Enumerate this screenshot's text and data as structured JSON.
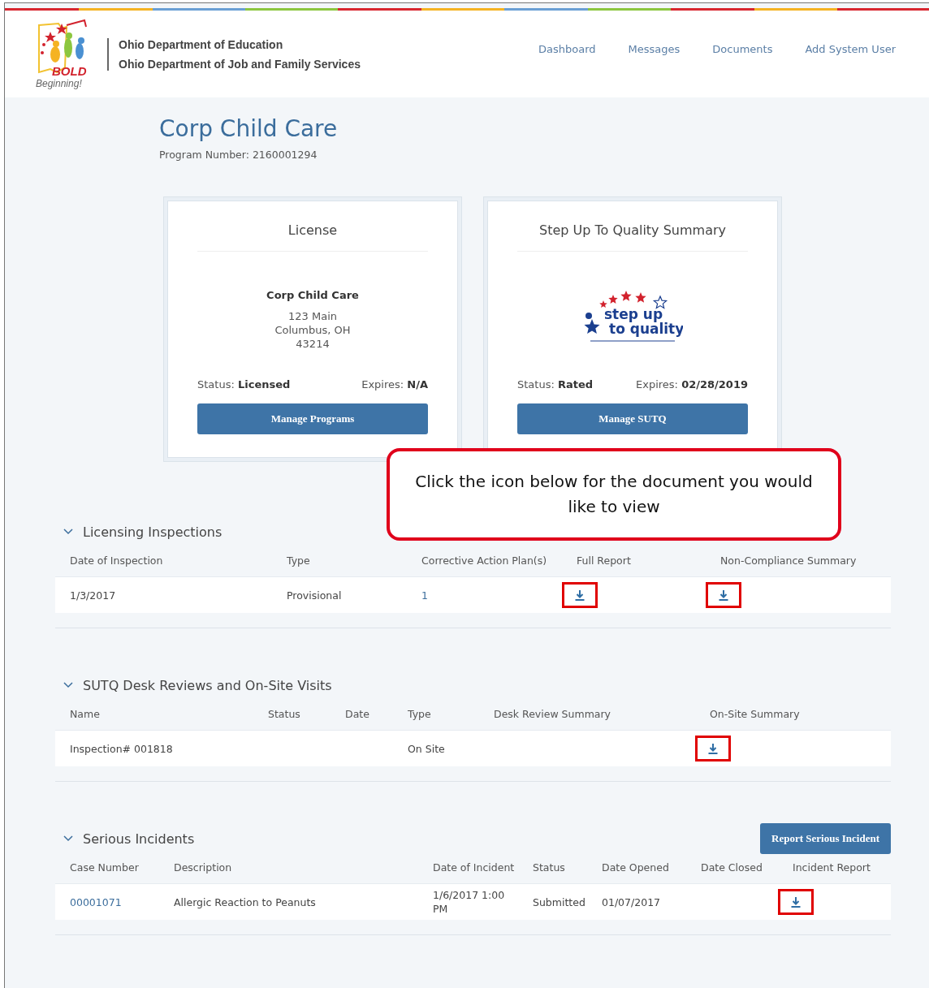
{
  "header": {
    "logo_text": [
      "BOLD",
      "Beginning!"
    ],
    "departments": [
      "Ohio Department of Education",
      "Ohio Department of Job and Family Services"
    ],
    "nav": [
      {
        "label": "Dashboard"
      },
      {
        "label": "Messages"
      },
      {
        "label": "Documents"
      },
      {
        "label": "Add System User"
      }
    ]
  },
  "program": {
    "title": "Corp Child Care",
    "number": "Program Number: 2160001294"
  },
  "cards": [
    {
      "kind": "license",
      "title": "License",
      "name": "Corp Child Care",
      "address": [
        "123 Main",
        "Columbus, OH",
        "43214"
      ],
      "status_label": "Status:",
      "status": "Licensed",
      "expires_label": "Expires:",
      "expires": "N/A",
      "button": "Manage Programs"
    },
    {
      "kind": "sutq",
      "title": "Step Up To Quality Summary",
      "logo_text": [
        "step up",
        "to quality"
      ],
      "status_label": "Status:",
      "status": "Rated",
      "expires_label": "Expires:",
      "expires": "02/28/2019",
      "button": "Manage SUTQ"
    }
  ],
  "callout": {
    "text": "Click the icon below for the document you would like to view"
  },
  "sections": [
    {
      "title": "Licensing Inspections",
      "expanded": true,
      "columns": [
        "Date of Inspection",
        "Type",
        "Corrective Action Plan(s)",
        "Full Report",
        "Non-Compliance Summary"
      ],
      "rows": [
        {
          "cells": [
            {
              "kind": "text",
              "text": "1/3/2017"
            },
            {
              "kind": "text",
              "text": "Provisional"
            },
            {
              "kind": "link",
              "text": "1"
            },
            {
              "kind": "download",
              "highlighted": true
            },
            {
              "kind": "download",
              "highlighted": true
            }
          ]
        }
      ]
    },
    {
      "title": "SUTQ Desk Reviews and On-Site Visits",
      "expanded": true,
      "columns": [
        "Name",
        "Status",
        "Date",
        "Type",
        "Desk Review Summary",
        "On-Site Summary"
      ],
      "rows": [
        {
          "cells": [
            {
              "kind": "text",
              "text": "Inspection# 001818"
            },
            {
              "kind": "empty"
            },
            {
              "kind": "empty"
            },
            {
              "kind": "text",
              "text": "On Site"
            },
            {
              "kind": "empty"
            },
            {
              "kind": "download",
              "highlighted": true
            }
          ]
        }
      ]
    },
    {
      "title": "Serious Incidents",
      "expanded": true,
      "action": "Report Serious Incident",
      "columns": [
        "Case Number",
        "Description",
        "Date of Incident",
        "Status",
        "Date Opened",
        "Date Closed",
        "Incident Report"
      ],
      "rows": [
        {
          "cells": [
            {
              "kind": "link",
              "text": "00001071"
            },
            {
              "kind": "text",
              "text": "Allergic Reaction to Peanuts"
            },
            {
              "kind": "text",
              "text": "1/6/2017 1:00 PM"
            },
            {
              "kind": "text",
              "text": "Submitted"
            },
            {
              "kind": "text",
              "text": "01/07/2017"
            },
            {
              "kind": "empty"
            },
            {
              "kind": "download",
              "highlighted": true
            }
          ]
        }
      ]
    }
  ]
}
